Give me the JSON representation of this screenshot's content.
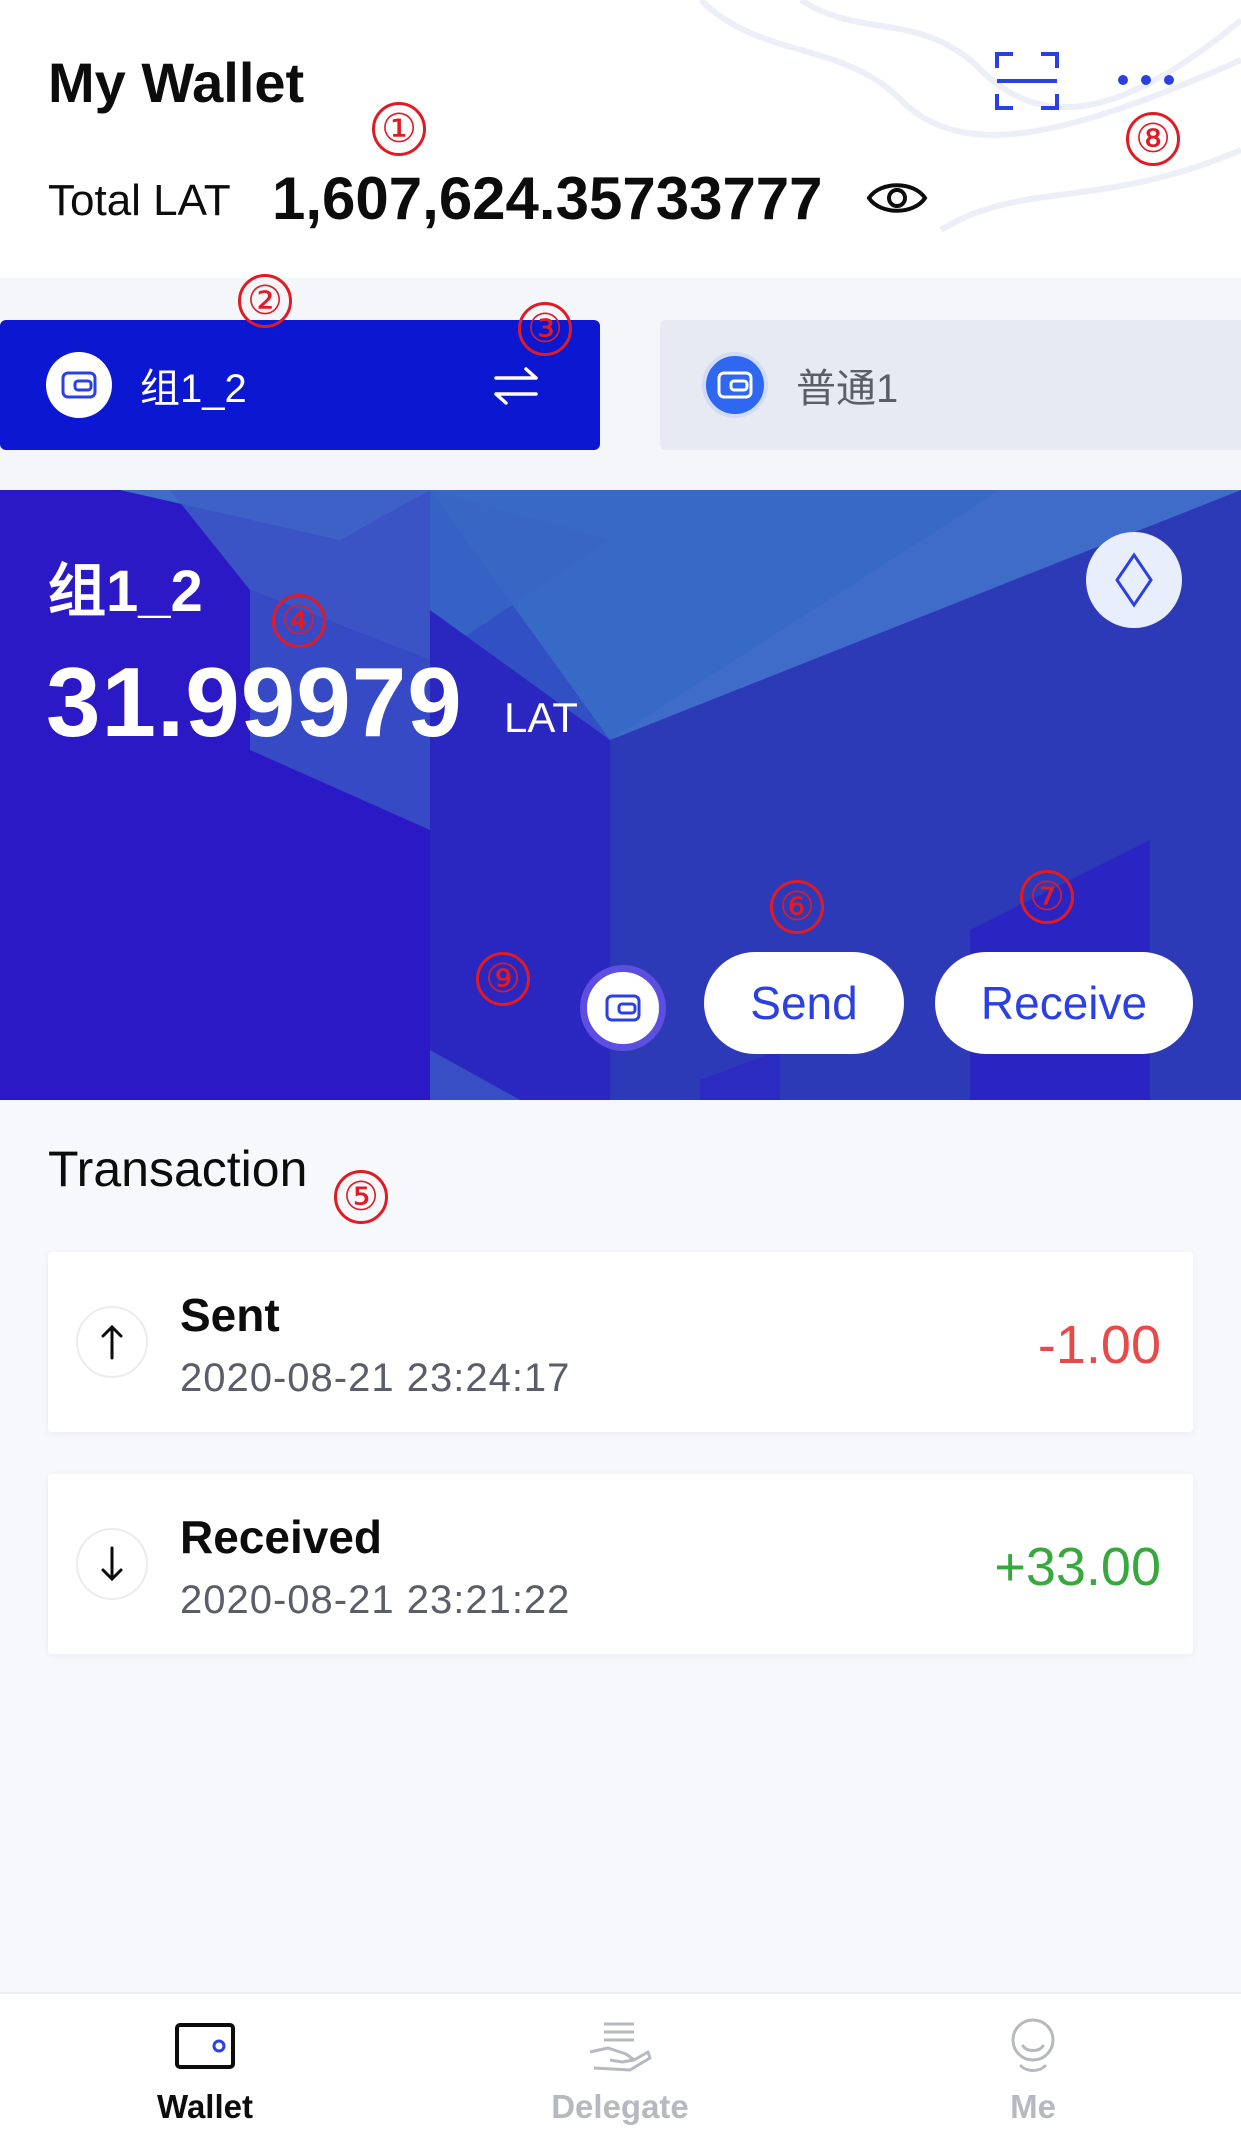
{
  "header": {
    "title": "My Wallet",
    "total_label": "Total LAT",
    "total_value": "1,607,624.35733777"
  },
  "tabs": [
    {
      "name": "组1_2",
      "active": true
    },
    {
      "name": "普通1",
      "active": false
    }
  ],
  "card": {
    "wallet_name": "组1_2",
    "balance": "31.99979",
    "unit": "LAT",
    "send_label": "Send",
    "receive_label": "Receive"
  },
  "transactions": {
    "title": "Transaction",
    "items": [
      {
        "type": "Sent",
        "time": "2020-08-21 23:24:17",
        "amount": "-1.00",
        "direction": "out"
      },
      {
        "type": "Received",
        "time": "2020-08-21 23:21:22",
        "amount": "+33.00",
        "direction": "in"
      }
    ]
  },
  "annotations": [
    "①",
    "②",
    "③",
    "④",
    "⑤",
    "⑥",
    "⑦",
    "⑧",
    "⑨"
  ],
  "nav": {
    "wallet": "Wallet",
    "delegate": "Delegate",
    "me": "Me"
  },
  "colors": {
    "accent": "#2b40e4",
    "card_bg": "#2a19c4",
    "tab_active": "#0b17d0",
    "negative": "#e84a4a",
    "positive": "#38a83d",
    "annotation": "#e01b24"
  },
  "icons": [
    "scan-icon",
    "more-icon",
    "eye-icon",
    "wallet-icon",
    "switch-icon",
    "diamond-icon",
    "arrow-up-icon",
    "arrow-down-icon",
    "delegate-icon",
    "me-icon"
  ]
}
